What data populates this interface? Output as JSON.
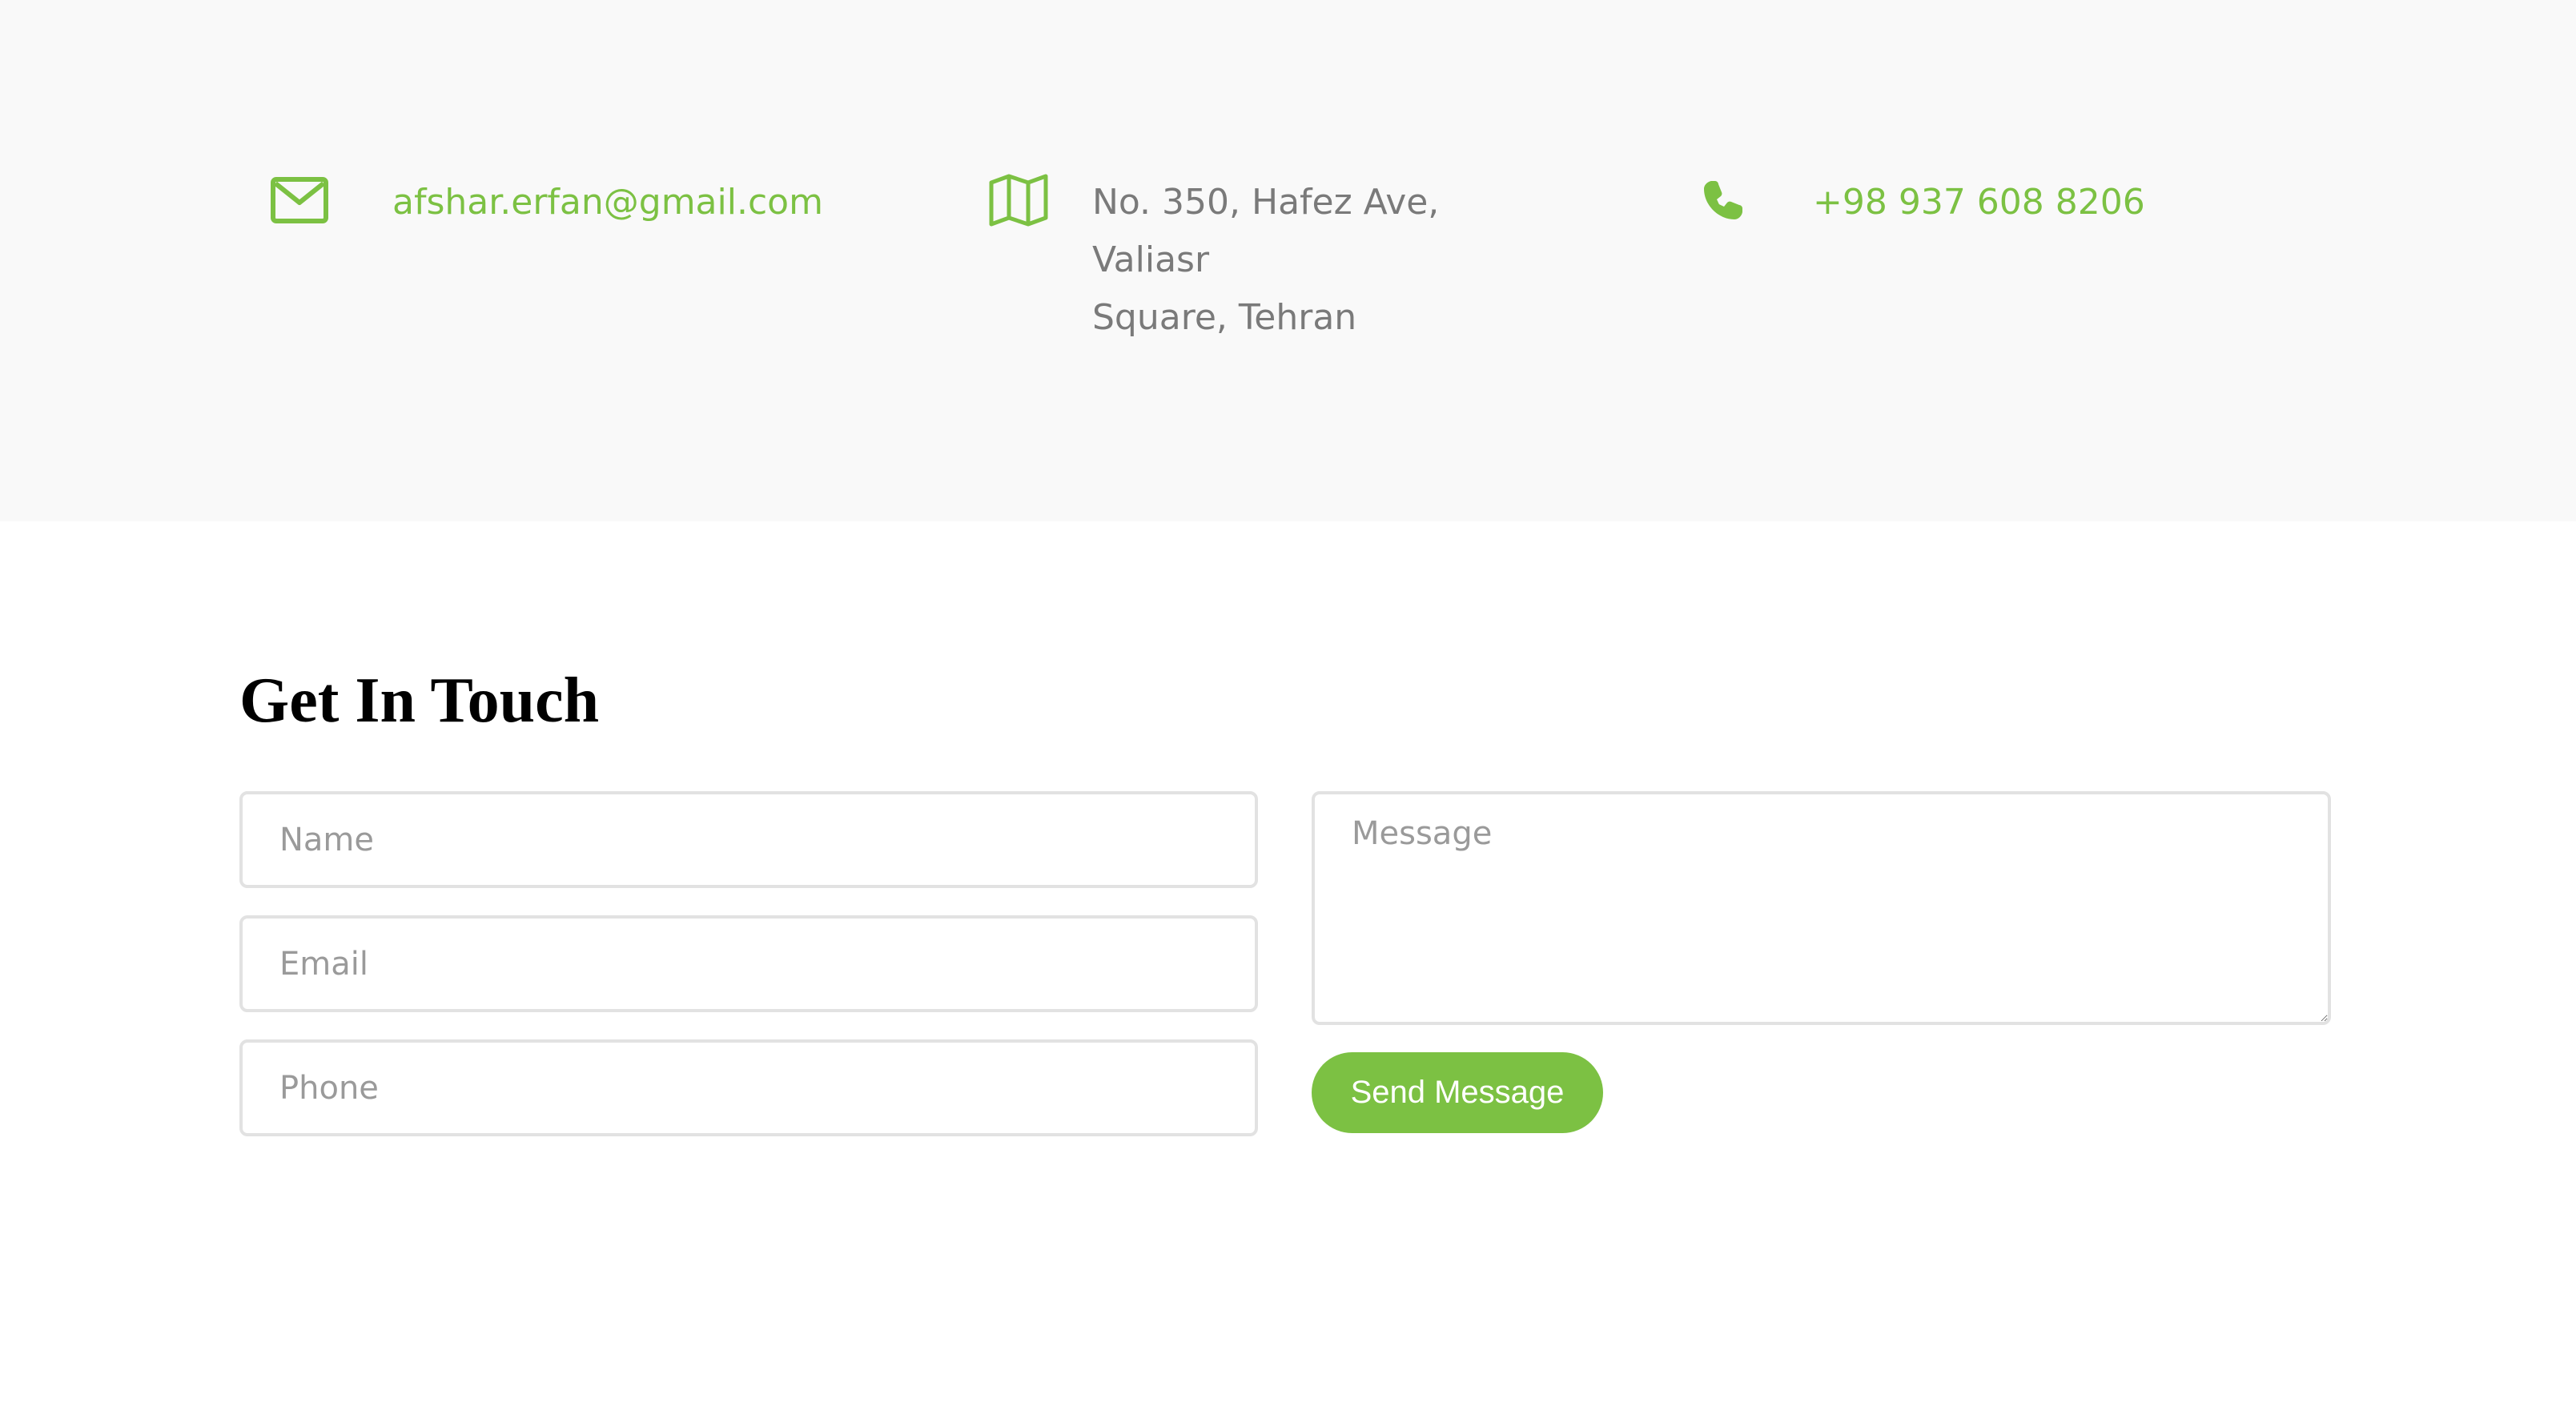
{
  "contact_info": {
    "email": "afshar.erfan@gmail.com",
    "address_line1": "No. 350, Hafez Ave, Valiasr",
    "address_line2": "Square, Tehran",
    "phone": "+98 937 608 8206",
    "icons": {
      "email": "envelope-icon",
      "address": "map-icon",
      "phone": "phone-icon"
    }
  },
  "form": {
    "heading": "Get In Touch",
    "name_placeholder": "Name",
    "email_placeholder": "Email",
    "phone_placeholder": "Phone",
    "message_placeholder": "Message",
    "send_label": "Send Message"
  },
  "colors": {
    "accent": "#7cc143",
    "band_background": "#f9f9f9",
    "muted_text": "#7a7a7a",
    "field_border": "#e2e2e2"
  }
}
